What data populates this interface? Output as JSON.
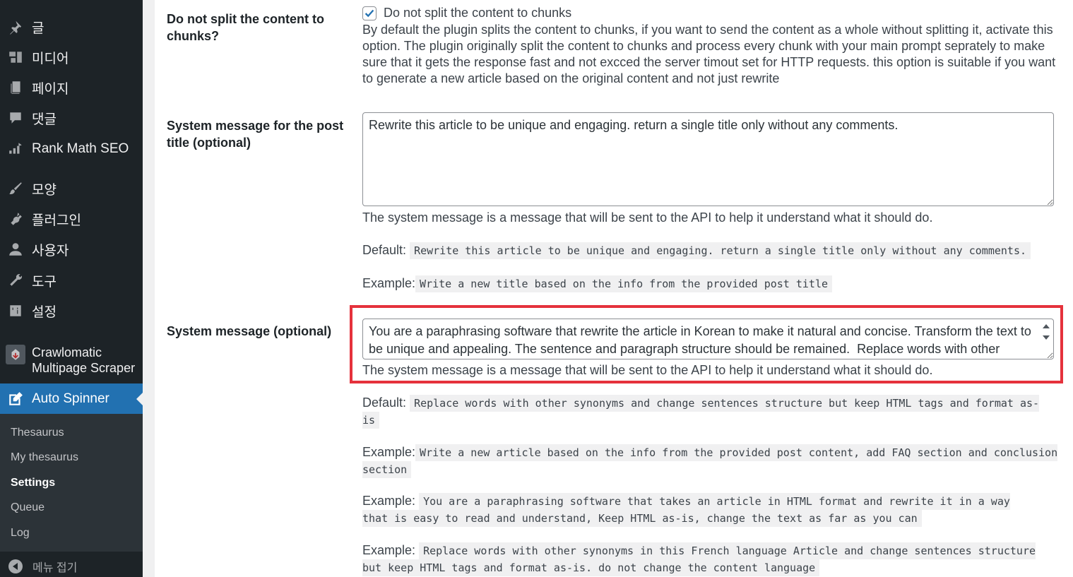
{
  "sidebar": {
    "items": [
      {
        "label": "글",
        "icon": "pushpin-icon"
      },
      {
        "label": "미디어",
        "icon": "media-icon"
      },
      {
        "label": "페이지",
        "icon": "page-icon"
      },
      {
        "label": "댓글",
        "icon": "comment-icon"
      },
      {
        "label": "Rank Math SEO",
        "icon": "rank-math-icon"
      },
      {
        "label": "모양",
        "icon": "paintbrush-icon"
      },
      {
        "label": "플러그인",
        "icon": "plugin-icon"
      },
      {
        "label": "사용자",
        "icon": "user-icon"
      },
      {
        "label": "도구",
        "icon": "wrench-icon"
      },
      {
        "label": "설정",
        "icon": "settings-icon"
      }
    ],
    "crawlomatic_line1": "Crawlomatic",
    "crawlomatic_line2": "Multipage Scraper",
    "auto_spinner": "Auto Spinner",
    "submenu": [
      "Thesaurus",
      "My thesaurus",
      "Settings",
      "Queue",
      "Log"
    ],
    "collapse": "메뉴 접기"
  },
  "settings": {
    "chunks": {
      "label_line1": "Do not split the content to",
      "label_line2": "chunks?",
      "checkbox_label": "Do not split the content to chunks",
      "checked": true,
      "description": "By default the plugin splits the content to chunks, if you want to send the content as a whole without splitting it, activate this option. The plugin originally split the content to chunks and process every chunk with your main prompt seprately to make sure that it gets the response fast and not excced the server timout set for HTTP requests. this option is suitable if you want to generate a new article based on the original content and not just rewrite"
    },
    "title_message": {
      "label_line1": "System message for the post",
      "label_line2": "title (optional)",
      "value": "Rewrite this article to be unique and engaging. return a single title only without any comments.",
      "description": "The system message is a message that will be sent to the API to help it understand what it should do.",
      "default_label": "Default:",
      "default_code": "Rewrite this article to be unique and engaging. return a single title only without any comments.",
      "example_label": "Example:",
      "example_code": "Write a new title based on the info from the provided post title"
    },
    "system_message": {
      "label": "System message (optional)",
      "value": "You are a paraphrasing software that rewrite the article in Korean to make it natural and concise. Transform the text to be unique and appealing. The sentence and paragraph structure should be remained.  Replace words with other synonyms",
      "description": "The system message is a message that will be sent to the API to help it understand what it should do.",
      "default_label": "Default:",
      "default_code": "Replace words with other synonyms and change sentences structure but keep HTML tags and format as-is",
      "examples": [
        {
          "label": "Example:",
          "code": "Write a new article based on the info from the provided post content, add FAQ section and conclusion section"
        },
        {
          "label": "Example:",
          "code": "You are a paraphrasing software that takes an article in HTML format and rewrite it in a way that is easy to read and understand, Keep HTML as-is, change the text as far as you can"
        },
        {
          "label": "Example:",
          "code": "Replace words with other synonyms in this French language Article and change sentences structure but keep HTML tags and format as-is. do not change the content language"
        }
      ]
    }
  },
  "colors": {
    "sidebar_bg": "#1d2327",
    "submenu_bg": "#2c3338",
    "accent": "#2271b1",
    "highlight": "#e5323c"
  }
}
